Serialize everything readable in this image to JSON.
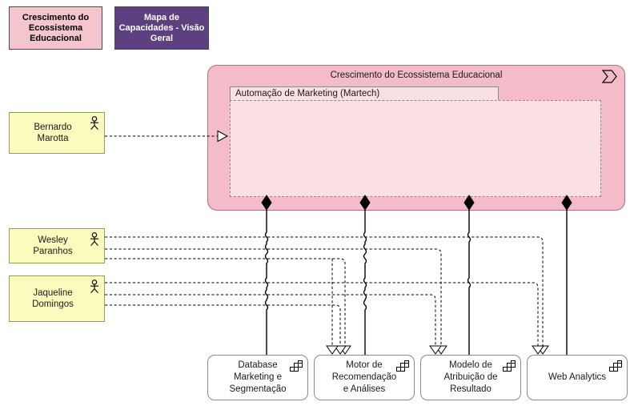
{
  "diagram": {
    "title": "Crescimento do Ecossistema Educacional",
    "type": "archimate-capability-map"
  },
  "tabs": [
    {
      "label": "Crescimento do Ecossistema Educacional",
      "color": "#f4c5cd",
      "text_color": "#000000",
      "active": false
    },
    {
      "label": "Mapa de Capacidades - Visão Geral",
      "color": "#5d4080",
      "text_color": "#ffffff",
      "active": true
    }
  ],
  "main_group": {
    "title": "Crescimento do Ecossistema Educacional",
    "icon": "value-stream-icon",
    "fill": "#f4bcc8",
    "nested_group": {
      "title": "Automação de Marketing (Martech)",
      "fill": "#fadfe4"
    }
  },
  "actors": [
    {
      "name": "Bernardo\nMarotta",
      "icon": "actor-stick-figure-icon",
      "fill": "#fbfbbd"
    },
    {
      "name": "Wesley\nParanhos",
      "icon": "actor-stick-figure-icon",
      "fill": "#fbfbbd"
    },
    {
      "name": "Jaqueline\nDomingos",
      "icon": "actor-stick-figure-icon",
      "fill": "#fbfbbd"
    }
  ],
  "capabilities": [
    {
      "name": "Database\nMarketing e\nSegmentação",
      "icon": "capability-grid-icon"
    },
    {
      "name": "Motor de\nRecomendação\ne Análises",
      "icon": "capability-grid-icon"
    },
    {
      "name": "Modelo de\nAtribuição de\nResultado",
      "icon": "capability-grid-icon"
    },
    {
      "name": "Web Analytics",
      "icon": "capability-grid-icon"
    }
  ],
  "relationships": {
    "composition_count": 4,
    "realization_count": 7,
    "composition_style": "solid-line-filled-diamond",
    "realization_style": "dashed-line-hollow-triangle"
  }
}
